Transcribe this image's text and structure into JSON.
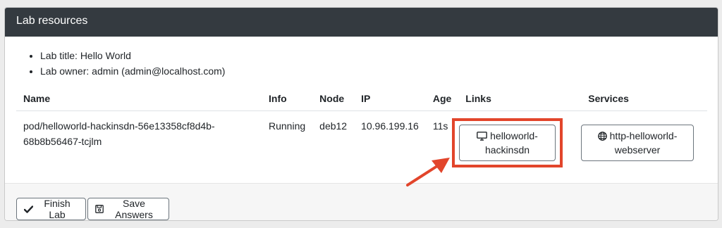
{
  "header": {
    "title": "Lab resources"
  },
  "lab_info": [
    "Lab title: Hello World",
    "Lab owner: admin (admin@localhost.com)"
  ],
  "table": {
    "columns": [
      "Name",
      "Info",
      "Node",
      "IP",
      "Age",
      "Links",
      "Services"
    ],
    "rows": [
      {
        "name": "pod/helloworld-hackinsdn-56e13358cf8d4b-68b8b56467-tcjlm",
        "name_line1": "pod/helloworld-hackinsdn-56e13358cf8d4b-",
        "name_line2": "68b8b56467-tcjlm",
        "info": "Running",
        "node": "deb12",
        "ip": "10.96.199.16",
        "age": "11s",
        "link_line1": "helloworld-",
        "link_line2": "hackinsdn",
        "service_line1": "http-helloworld-",
        "service_line2": "webserver"
      }
    ]
  },
  "footer": {
    "finish_label": "Finish Lab",
    "save_label": "Save Answers"
  },
  "colors": {
    "header_bg": "#343a40",
    "highlight": "#e2452b"
  },
  "icons": {
    "link": "monitor-icon",
    "service": "globe-icon",
    "finish": "check-icon",
    "save": "floppy-disk-icon"
  }
}
